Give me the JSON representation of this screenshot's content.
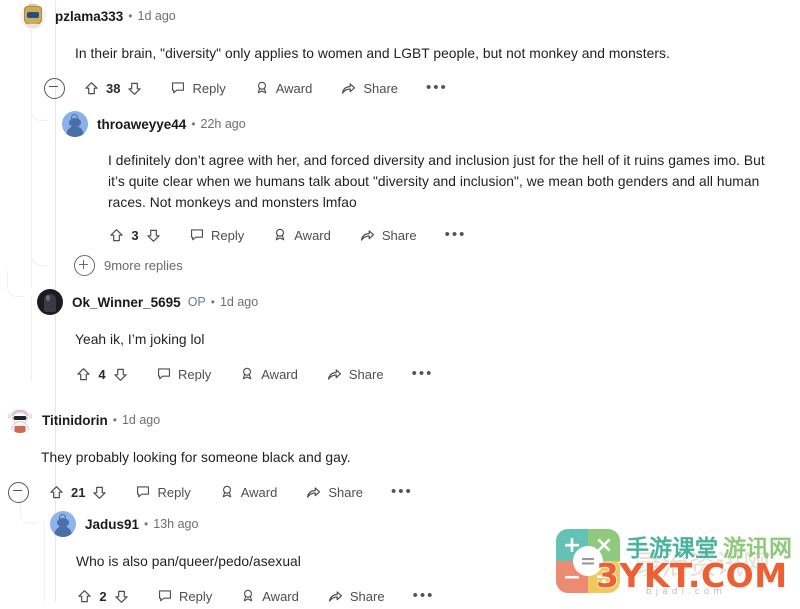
{
  "app": "reddit-comment-thread",
  "icons": {
    "upvote": "upvote-arrow-icon",
    "downvote": "downvote-arrow-icon",
    "reply": "speech-bubble-icon",
    "award": "award-ribbon-icon",
    "share": "share-arrow-icon",
    "overflow": "•••",
    "collapse": "collapse-minus-icon",
    "expand": "expand-plus-icon"
  },
  "labels": {
    "reply": "Reply",
    "award": "Award",
    "share": "Share",
    "separator": "•"
  },
  "comments": [
    {
      "id": "pzlama333",
      "username": "pzlama333",
      "timestamp": "1d ago",
      "op": "",
      "body": "In their brain, \"diversity\" only applies to women and LGBT people, but not monkey and monsters.",
      "score": "38",
      "avatar": "robot-gold-avatar"
    },
    {
      "id": "throaweyye44",
      "username": "throaweyye44",
      "timestamp": "22h ago",
      "op": "",
      "body": "I definitely don’t agree with her, and forced diversity and inclusion just for the hell of it ruins games imo. But it’s quite clear when we humans talk about \"diversity and inclusion\", we mean both genders and all human races. Not monkeys and monsters lmfao",
      "score": "3",
      "avatar": "snoo-blue-avatar"
    },
    {
      "id": "Ok_Winner_5695",
      "username": "Ok_Winner_5695",
      "timestamp": "1d ago",
      "op": "OP",
      "body": "Yeah ik, I’m joking lol",
      "score": "4",
      "avatar": "photo-dark-avatar"
    },
    {
      "id": "Titinidorin",
      "username": "Titinidorin",
      "timestamp": "1d ago",
      "op": "",
      "body": "They probably looking for someone black and gay.",
      "score": "21",
      "avatar": "snoo-white-sunglasses-avatar"
    },
    {
      "id": "Jadus91",
      "username": "Jadus91",
      "timestamp": "13h ago",
      "op": "",
      "body": "Who is also pan/queer/pedo/asexual",
      "score": "2",
      "avatar": "snoo-blue-avatar"
    }
  ],
  "more_replies": {
    "label": "9more replies"
  },
  "watermark": {
    "quadrant_top_left": "+",
    "quadrant_top_right": "×",
    "quadrant_bottom_left": "−",
    "quadrant_bottom_right": "÷",
    "center": "=",
    "brand_primary": "手游课堂",
    "brand_secondary": "游讯网",
    "domain": "3YKT.COM",
    "ghost_text": "录治资讯网",
    "subdomain": "bjadi.com",
    "color_primary": "#49b39e",
    "color_secondary": "#8fca7c",
    "color_domain": "#ec6034"
  }
}
